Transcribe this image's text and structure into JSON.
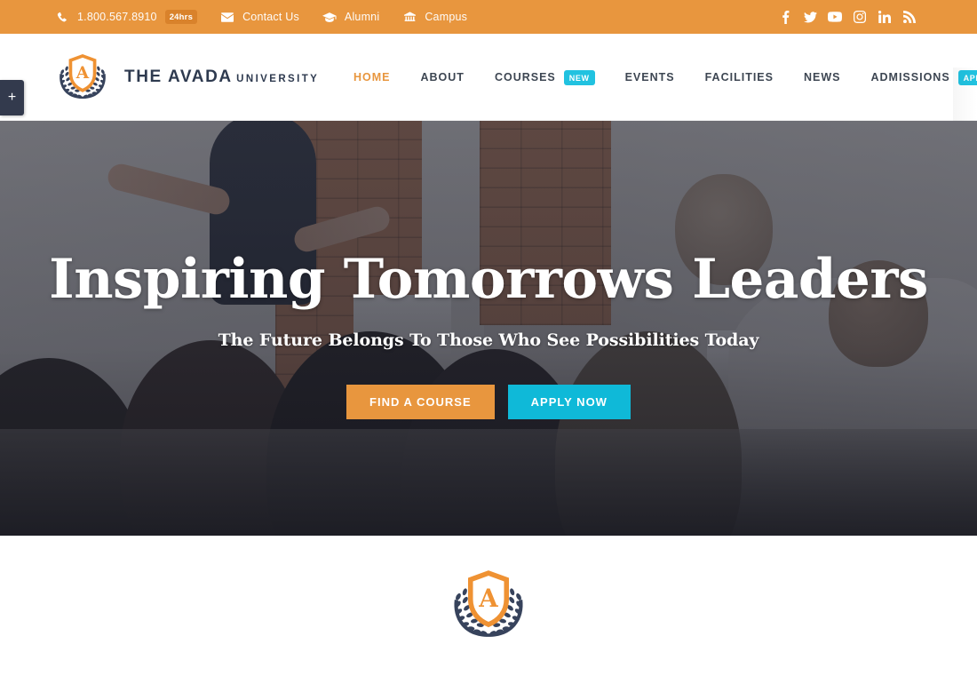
{
  "topbar": {
    "phone": {
      "icon": "phone-icon",
      "text": "1.800.567.8910",
      "badge": "24hrs"
    },
    "items": [
      {
        "icon": "envelope-icon",
        "label": "Contact Us"
      },
      {
        "icon": "graduation-cap-icon",
        "label": "Alumni"
      },
      {
        "icon": "bank-icon",
        "label": "Campus"
      }
    ],
    "social": [
      {
        "name": "facebook-icon",
        "label": "Facebook"
      },
      {
        "name": "twitter-icon",
        "label": "Twitter"
      },
      {
        "name": "youtube-icon",
        "label": "YouTube"
      },
      {
        "name": "instagram-icon",
        "label": "Instagram"
      },
      {
        "name": "linkedin-icon",
        "label": "LinkedIn"
      },
      {
        "name": "rss-icon",
        "label": "RSS"
      }
    ]
  },
  "brand": {
    "title": "THE AVADA",
    "subtitle": "UNIVERSITY"
  },
  "side_tab": {
    "label": "+"
  },
  "nav": {
    "items": [
      {
        "label": "HOME",
        "active": true,
        "badge": ""
      },
      {
        "label": "ABOUT",
        "active": false,
        "badge": ""
      },
      {
        "label": "COURSES",
        "active": false,
        "badge": "NEW"
      },
      {
        "label": "EVENTS",
        "active": false,
        "badge": ""
      },
      {
        "label": "FACILITIES",
        "active": false,
        "badge": ""
      },
      {
        "label": "NEWS",
        "active": false,
        "badge": ""
      },
      {
        "label": "ADMISSIONS",
        "active": false,
        "badge": "APPLY"
      }
    ]
  },
  "hero": {
    "title": "Inspiring Tomorrows Leaders",
    "subtitle": "The Future Belongs To Those Who See Possibilities Today",
    "buttons": [
      {
        "label": "FIND A COURSE",
        "style": "orange"
      },
      {
        "label": "APPLY NOW",
        "style": "cyan"
      }
    ],
    "background_image": "classroom-presentation-photo"
  },
  "bottom": {
    "logo": "avada-university-crest-icon"
  },
  "colors": {
    "orange": "#e8963e",
    "orange_dark": "#d9822b",
    "cyan": "#21c2e0",
    "cyan_button": "#0fb9d8",
    "navy": "#2e3a4f",
    "nav_text": "#3d4652",
    "white": "#ffffff"
  }
}
